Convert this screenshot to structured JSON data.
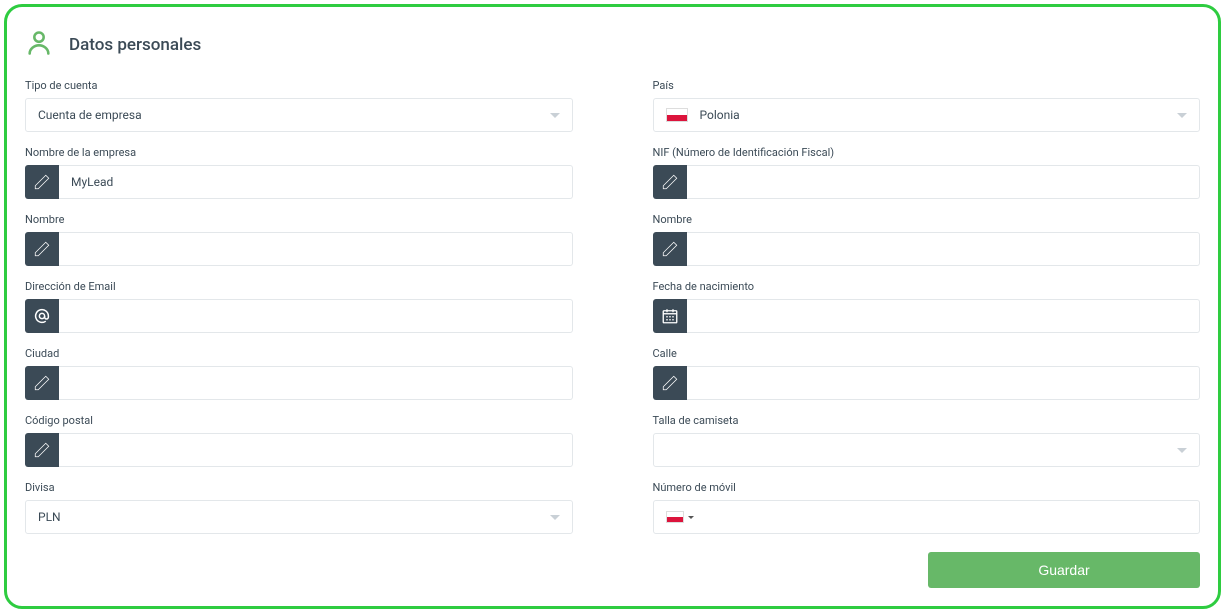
{
  "header": {
    "title": "Datos personales"
  },
  "left": {
    "account_type": {
      "label": "Tipo de cuenta",
      "value": "Cuenta de empresa"
    },
    "company_name": {
      "label": "Nombre de la empresa",
      "value": "MyLead"
    },
    "first_name": {
      "label": "Nombre",
      "value": ""
    },
    "email": {
      "label": "Dirección de Email",
      "value": ""
    },
    "city": {
      "label": "Ciudad",
      "value": ""
    },
    "postal": {
      "label": "Código postal",
      "value": ""
    },
    "currency": {
      "label": "Divisa",
      "value": "PLN"
    }
  },
  "right": {
    "country": {
      "label": "País",
      "value": "Polonia"
    },
    "nif": {
      "label": "NIF (Número de Identificación Fiscal)",
      "value": ""
    },
    "name2": {
      "label": "Nombre",
      "value": ""
    },
    "birthdate": {
      "label": "Fecha de nacimiento",
      "value": ""
    },
    "street": {
      "label": "Calle",
      "value": ""
    },
    "shirt": {
      "label": "Talla de camiseta",
      "value": ""
    },
    "mobile": {
      "label": "Número de móvil",
      "value": ""
    }
  },
  "actions": {
    "save": "Guardar"
  }
}
